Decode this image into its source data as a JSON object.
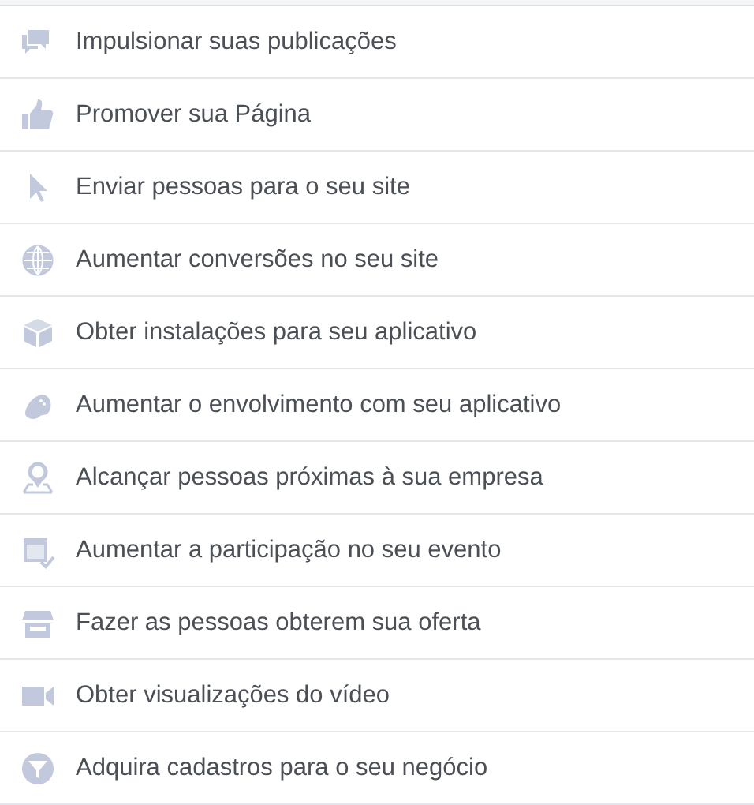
{
  "objectives": [
    {
      "label": "Impulsionar suas publicações"
    },
    {
      "label": "Promover sua Página"
    },
    {
      "label": "Enviar pessoas para o seu site"
    },
    {
      "label": "Aumentar conversões no seu site"
    },
    {
      "label": "Obter instalações para seu aplicativo"
    },
    {
      "label": "Aumentar o envolvimento com seu aplicativo"
    },
    {
      "label": "Alcançar pessoas próximas à sua empresa"
    },
    {
      "label": "Aumentar a participação no seu evento"
    },
    {
      "label": "Fazer as pessoas obterem sua oferta"
    },
    {
      "label": "Obter visualizações do vídeo"
    },
    {
      "label": "Adquira cadastros para o seu negócio"
    }
  ]
}
